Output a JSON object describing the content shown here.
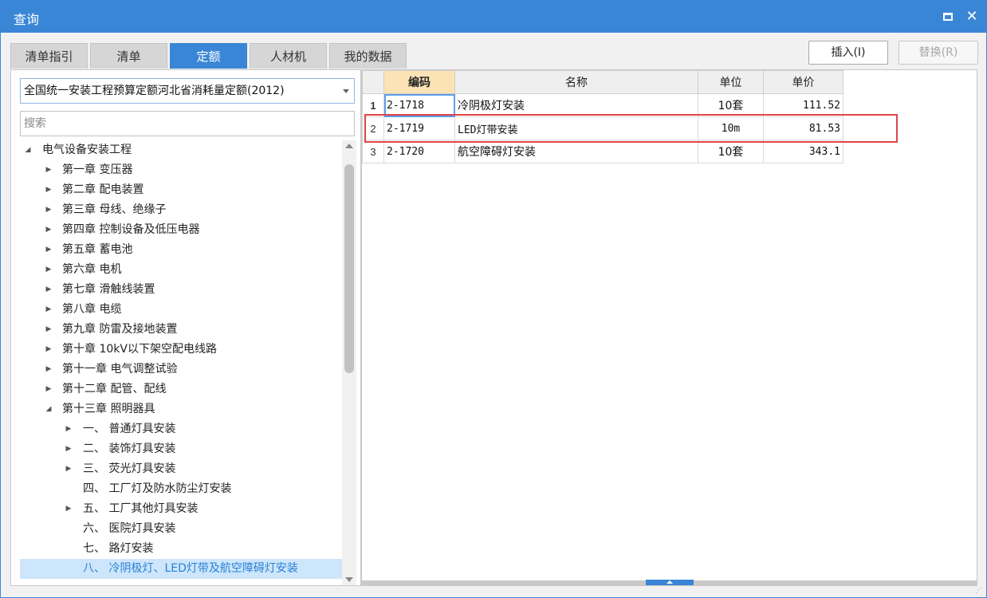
{
  "window": {
    "title": "查询"
  },
  "tabs": [
    {
      "label": "清单指引"
    },
    {
      "label": "清单"
    },
    {
      "label": "定额"
    },
    {
      "label": "人材机"
    },
    {
      "label": "我的数据"
    }
  ],
  "actions": {
    "insert_label": "插入(I)",
    "replace_label": "替换(R)"
  },
  "left": {
    "dropdown_value": "全国统一安装工程预算定额河北省消耗量定额(2012)",
    "search_placeholder": "搜索",
    "tree": [
      {
        "label": "电气设备安装工程",
        "expanded": true
      },
      {
        "label": "第一章 变压器"
      },
      {
        "label": "第二章 配电装置"
      },
      {
        "label": "第三章 母线、绝缘子"
      },
      {
        "label": "第四章 控制设备及低压电器"
      },
      {
        "label": "第五章 蓄电池"
      },
      {
        "label": "第六章 电机"
      },
      {
        "label": "第七章 滑触线装置"
      },
      {
        "label": "第八章 电缆"
      },
      {
        "label": "第九章 防雷及接地装置"
      },
      {
        "label": "第十章 10kV以下架空配电线路"
      },
      {
        "label": "第十一章 电气调整试验"
      },
      {
        "label": "第十二章 配管、配线"
      },
      {
        "label": "第十三章 照明器具",
        "expanded": true
      },
      {
        "label": "一、 普通灯具安装"
      },
      {
        "label": "二、 装饰灯具安装"
      },
      {
        "label": "三、 荧光灯具安装"
      },
      {
        "label": "四、 工厂灯及防水防尘灯安装"
      },
      {
        "label": "五、 工厂其他灯具安装"
      },
      {
        "label": "六、 医院灯具安装"
      },
      {
        "label": "七、 路灯安装"
      },
      {
        "label": "八、 冷阴极灯、LED灯带及航空障碍灯安装",
        "selected": true
      }
    ]
  },
  "table": {
    "headers": [
      "编码",
      "名称",
      "单位",
      "单价"
    ],
    "rows": [
      {
        "num": "1",
        "code": "2-1718",
        "name": "冷阴极灯安装",
        "unit": "10套",
        "price": "111.52"
      },
      {
        "num": "2",
        "code": "2-1719",
        "name": "LED灯带安装",
        "unit": "10m",
        "price": "81.53"
      },
      {
        "num": "3",
        "code": "2-1720",
        "name": "航空障碍灯安装",
        "unit": "10套",
        "price": "343.1"
      }
    ]
  },
  "colors": {
    "accent": "#3a86d6",
    "highlight": "#e0444a",
    "selected_bg": "#cde6fb"
  }
}
